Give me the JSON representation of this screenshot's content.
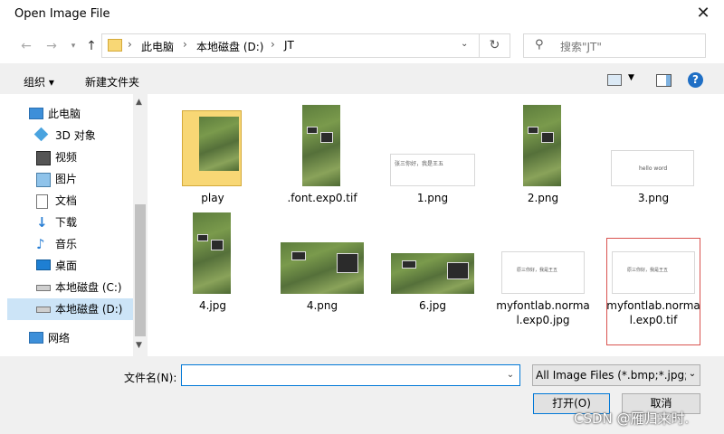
{
  "window": {
    "title": "Open Image File"
  },
  "nav": {
    "path": [
      "此电脑",
      "本地磁盘 (D:)",
      "JT"
    ],
    "search_placeholder": "搜索\"JT\""
  },
  "toolbar": {
    "organize": "组织 ▾",
    "new_folder": "新建文件夹"
  },
  "sidebar": {
    "items": [
      {
        "label": "此电脑",
        "icon": "computer-icon"
      },
      {
        "label": "3D 对象",
        "icon": "cube-icon"
      },
      {
        "label": "视频",
        "icon": "video-icon"
      },
      {
        "label": "图片",
        "icon": "pictures-icon"
      },
      {
        "label": "文档",
        "icon": "document-icon"
      },
      {
        "label": "下载",
        "icon": "download-icon"
      },
      {
        "label": "音乐",
        "icon": "music-icon"
      },
      {
        "label": "桌面",
        "icon": "desktop-icon"
      },
      {
        "label": "本地磁盘 (C:)",
        "icon": "drive-icon"
      },
      {
        "label": "本地磁盘 (D:)",
        "icon": "drive-icon"
      },
      {
        "label": "网络",
        "icon": "network-icon"
      }
    ]
  },
  "files": [
    {
      "name": "play",
      "type": "folder"
    },
    {
      "name": ".font.exp0.tif",
      "type": "game-tall"
    },
    {
      "name": "1.png",
      "type": "text-image",
      "text": "张三你好，我是王五"
    },
    {
      "name": "2.png",
      "type": "game-tall"
    },
    {
      "name": "3.png",
      "type": "text-image",
      "text": "hello word"
    },
    {
      "name": "4.jpg",
      "type": "game-tall"
    },
    {
      "name": "4.png",
      "type": "game-wide"
    },
    {
      "name": "6.jpg",
      "type": "game-wide"
    },
    {
      "name": "myfontlab.normal.exp0.jpg",
      "type": "text-image",
      "text": "原三你好，我是王五"
    },
    {
      "name": "myfontlab.normal.exp0.tif",
      "type": "text-image",
      "text": "原三你好，我是王五"
    }
  ],
  "bottom": {
    "filename_label": "文件名(N):",
    "filename_value": "",
    "filetype": "All Image Files (*.bmp;*.jpg;*",
    "open_label": "打开(O)",
    "cancel_label": "取消"
  },
  "watermark": "CSDN @雁归来时.",
  "colors": {
    "selection": "#cce4f7",
    "accent": "#0078d7",
    "help": "#1f6fc5",
    "folder": "#f8d775"
  }
}
